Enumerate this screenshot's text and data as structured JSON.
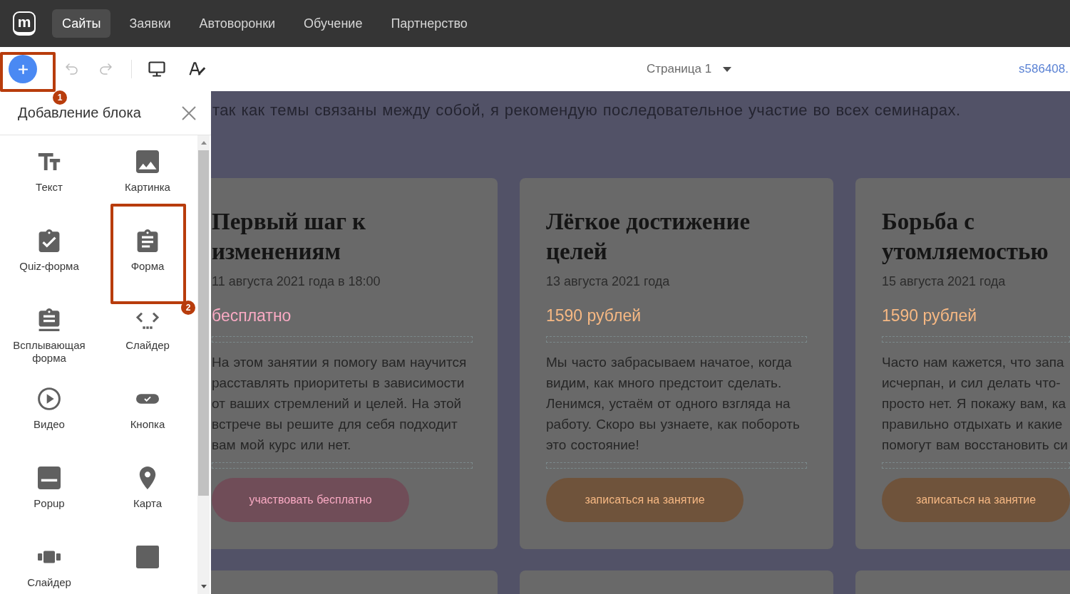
{
  "nav": {
    "logo_letter": "m",
    "items": [
      {
        "label": "Сайты",
        "selected": true
      },
      {
        "label": "Заявки",
        "selected": false
      },
      {
        "label": "Автоворонки",
        "selected": false
      },
      {
        "label": "Обучение",
        "selected": false
      },
      {
        "label": "Партнерство",
        "selected": false
      }
    ]
  },
  "toolbar": {
    "add_button": {
      "annotation": "1"
    },
    "history": [
      {
        "kind": "undo",
        "disabled": true
      },
      {
        "kind": "redo",
        "disabled": true
      }
    ],
    "view_tools": [
      {
        "kind": "desktop"
      },
      {
        "kind": "typography"
      }
    ],
    "page_selector": "Страница 1",
    "site_link": "s586408."
  },
  "panel": {
    "title": "Добавление блока",
    "items": [
      {
        "kind": "text",
        "label": "Текст"
      },
      {
        "kind": "image",
        "label": "Картинка"
      },
      {
        "kind": "quiz",
        "label": "Quiz-форма"
      },
      {
        "kind": "form",
        "label": "Форма",
        "annotation": "2"
      },
      {
        "kind": "popup_form",
        "label": "Всплывающая форма"
      },
      {
        "kind": "slider",
        "label": "Слайдер"
      },
      {
        "kind": "video",
        "label": "Видео"
      },
      {
        "kind": "button",
        "label": "Кнопка"
      },
      {
        "kind": "popup",
        "label": "Popup"
      },
      {
        "kind": "map",
        "label": "Карта"
      },
      {
        "kind": "carousel",
        "label": "Слайдер"
      },
      {
        "kind": "block"
      }
    ]
  },
  "page": {
    "intro": "так как темы связаны между собой, я рекомендую последовательное участие во всех семинарах.",
    "cards": [
      {
        "title": "Первый шаг к изменениям",
        "date": "11 августа 2021 года в 18:00",
        "price": "бесплатно",
        "color": "#f9aac3",
        "description": "На этом занятии я помогу вам научится расставлять приоритеты в зависимости от ваших стремлений и целей. На этой встрече вы решите для себя подходит вам мой курс или нет.",
        "button": "участвовать бесплатно"
      },
      {
        "title": "Лёгкое достижение целей",
        "date": "13 августа 2021 года",
        "price": "1590 рублей",
        "color": "#f6b883",
        "description": "Мы часто забрасываем начатое, когда видим, как много предстоит сделать. Ленимся, устаём от одного взгляда на работу. Скоро вы узнаете, как побороть это состояние!",
        "button": "записаться на занятие"
      },
      {
        "title": "Борьба с утомляемостью",
        "date": "15 августа 2021 года",
        "price": "1590 рублей",
        "color": "#f6b883",
        "description_lines": [
          "Часто нам кажется, что запа",
          "исчерпан, и сил делать что-",
          "просто нет. Я покажу вам, ка",
          "правильно отдыхать и какие",
          "помогут вам восстановить си"
        ],
        "button": "записаться на занятие"
      }
    ]
  }
}
